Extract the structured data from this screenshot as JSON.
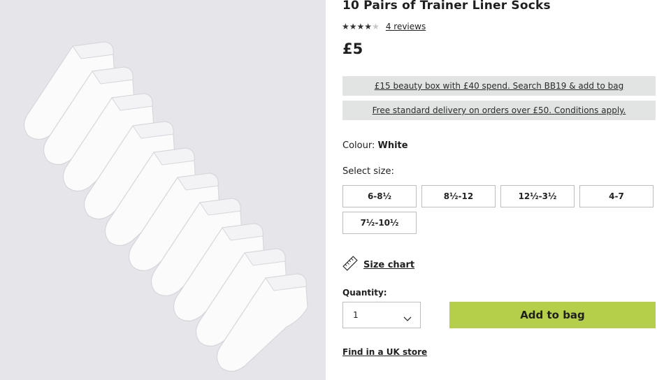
{
  "product": {
    "title": "10 Pairs of Trainer Liner Socks",
    "rating": {
      "filled_stars": 4,
      "total_stars": 5
    },
    "reviews_link": "4 reviews",
    "price": "£5",
    "image_alt": "white trainer liner socks"
  },
  "banners": [
    "£15 beauty box with £40 spend. Search BB19 & add to bag",
    "Free standard delivery on orders over £50. Conditions apply."
  ],
  "colour": {
    "label": "Colour:",
    "value": "White"
  },
  "size": {
    "label": "Select size:",
    "options": [
      "6-8½",
      "8½-12",
      "12½-3½",
      "4-7",
      "7½-10½"
    ]
  },
  "size_chart": {
    "label": "Size chart",
    "icon": "ruler-icon"
  },
  "quantity": {
    "label": "Quantity:",
    "value": "1"
  },
  "actions": {
    "add_to_bag": "Add to bag",
    "find_store": "Find in a UK store"
  },
  "colors": {
    "add_button": "#b5cf4a",
    "banner_bg": "#e2e3e3",
    "image_bg": "#e5e5ea"
  }
}
